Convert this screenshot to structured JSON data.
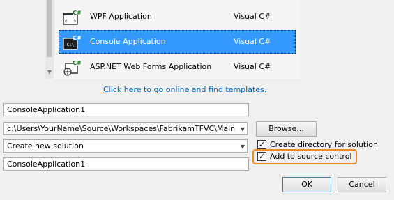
{
  "templates": [
    {
      "name": "WPF Application",
      "language": "Visual C#",
      "icon": "wpf-app-icon",
      "selected": false
    },
    {
      "name": "Console Application",
      "language": "Visual C#",
      "icon": "console-app-icon",
      "selected": true
    },
    {
      "name": "ASP.NET Web Forms Application",
      "language": "Visual C#",
      "icon": "web-forms-app-icon",
      "selected": false
    }
  ],
  "icon_badge": "C#",
  "console_glyph": "C:\\",
  "online_link": "Click here to go online and find templates.",
  "form": {
    "name_value": "ConsoleApplication1",
    "location_value": "c:\\Users\\YourName\\Source\\Workspaces\\FabrikamTFVC\\Main",
    "solution_value": "Create new solution",
    "solution_name_value": "ConsoleApplication1",
    "browse_label": "Browse...",
    "create_dir_label": "Create directory for solution",
    "create_dir_checked": true,
    "source_control_label": "Add to source control",
    "source_control_checked": true,
    "ok_label": "OK",
    "cancel_label": "Cancel"
  },
  "colors": {
    "selection": "#3399ff",
    "link": "#0066cc",
    "highlight": "#f08a24"
  }
}
